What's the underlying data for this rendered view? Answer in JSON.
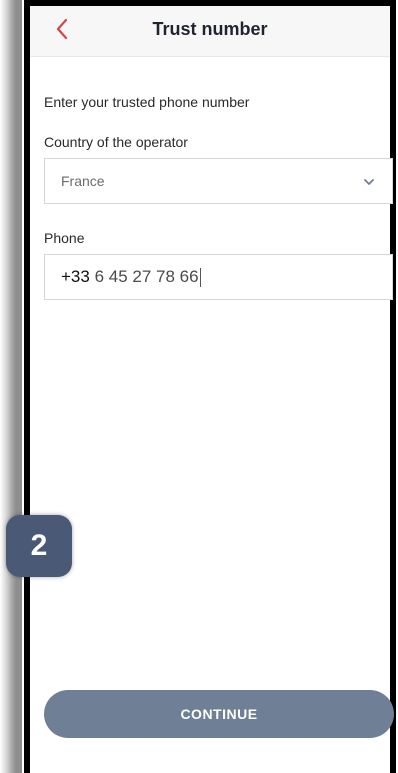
{
  "header": {
    "title": "Trust number",
    "back_icon": "chevron-left-icon",
    "back_color": "#d64545"
  },
  "form": {
    "intro": "Enter your trusted phone number",
    "country_label": "Country of the operator",
    "country_value": "France",
    "country_chevron_icon": "chevron-down-icon",
    "phone_label": "Phone",
    "phone_prefix": "+33",
    "phone_number": "6 45 27 78 66"
  },
  "step_badge": "2",
  "continue_label": "CONTINUE",
  "colors": {
    "badge": "#4a5a76",
    "button": "#6f7f95"
  }
}
